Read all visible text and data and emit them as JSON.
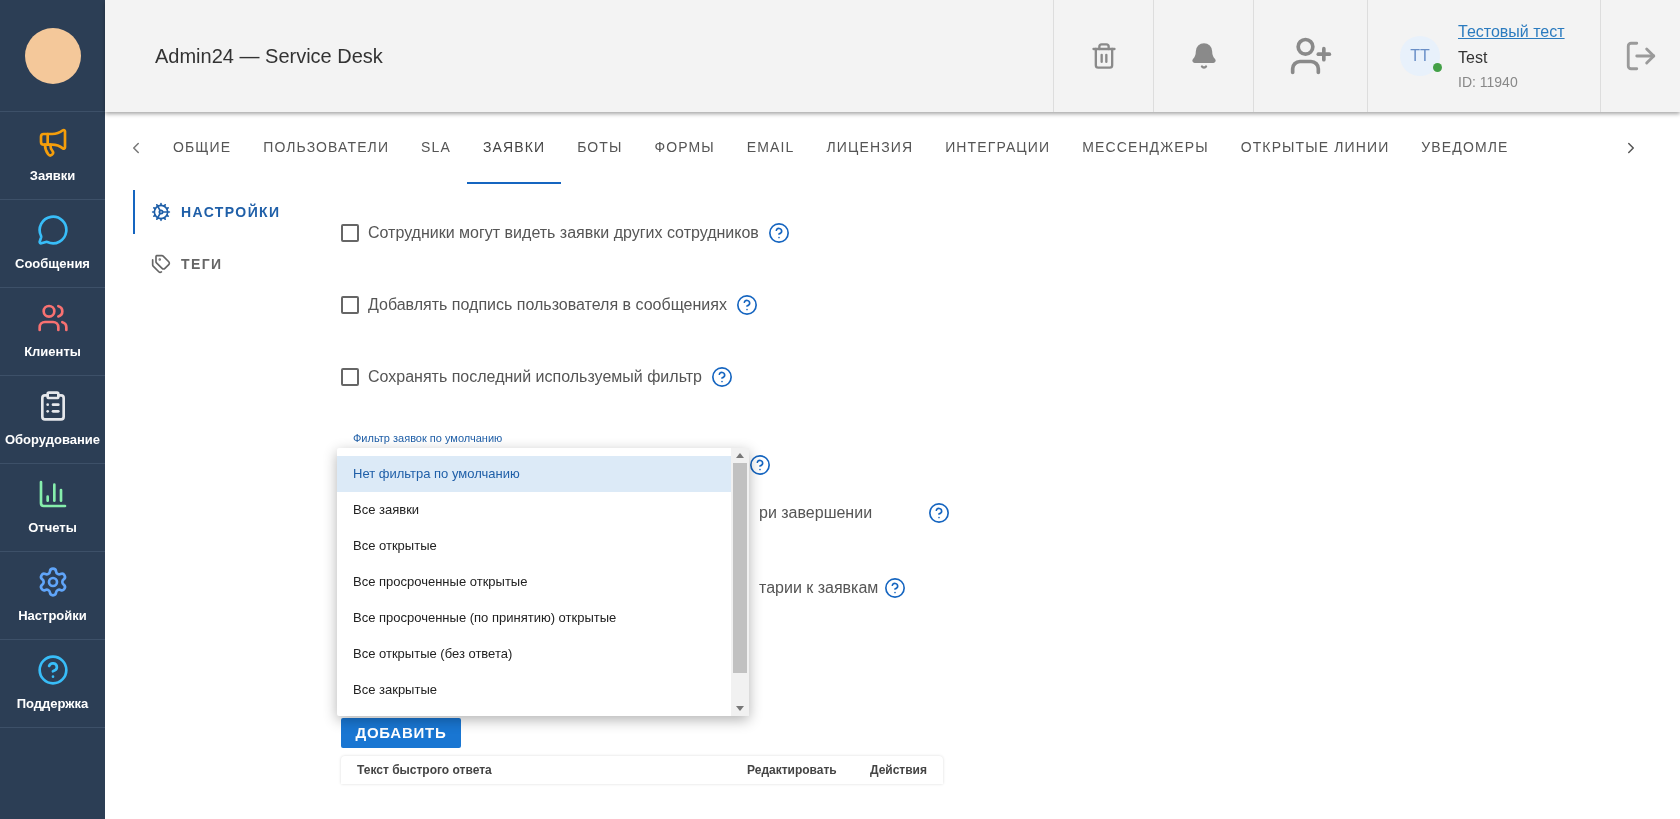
{
  "sidebar": {
    "items": [
      {
        "label": "Заявки"
      },
      {
        "label": "Сообщения"
      },
      {
        "label": "Клиенты"
      },
      {
        "label": "Оборудование"
      },
      {
        "label": "Отчеты"
      },
      {
        "label": "Настройки"
      },
      {
        "label": "Поддержка"
      }
    ]
  },
  "header": {
    "title": "Admin24 — Service Desk",
    "user": {
      "initials": "TT",
      "online": true,
      "name": "Тестовый тест",
      "login": "Test",
      "id": "ID: 11940"
    }
  },
  "tabs": [
    {
      "label": "ОБЩИЕ",
      "selected": false
    },
    {
      "label": "ПОЛЬЗОВАТЕЛИ",
      "selected": false
    },
    {
      "label": "SLA",
      "selected": false
    },
    {
      "label": "ЗАЯВКИ",
      "selected": true
    },
    {
      "label": "БОТЫ",
      "selected": false
    },
    {
      "label": "ФОРМЫ",
      "selected": false
    },
    {
      "label": "EMAIL",
      "selected": false
    },
    {
      "label": "ЛИЦЕНЗИЯ",
      "selected": false
    },
    {
      "label": "ИНТЕГРАЦИИ",
      "selected": false
    },
    {
      "label": "МЕССЕНДЖЕРЫ",
      "selected": false
    },
    {
      "label": "ОТКРЫТЫЕ ЛИНИИ",
      "selected": false
    },
    {
      "label": "УВЕДОМЛЕ",
      "selected": false
    }
  ],
  "subnav": [
    {
      "label": "НАСТРОЙКИ",
      "selected": true
    },
    {
      "label": "ТЕГИ",
      "selected": false
    }
  ],
  "settings": [
    {
      "label": "Сотрудники могут видеть заявки других сотрудников",
      "checked": false
    },
    {
      "label": "Добавлять подпись пользователя в сообщениях",
      "checked": false
    },
    {
      "label": "Сохранять последний используемый фильтр",
      "checked": false
    }
  ],
  "filter_select": {
    "label": "Фильтр заявок по умолчанию",
    "options": [
      {
        "label": "Нет фильтра по умолчанию",
        "selected": true
      },
      {
        "label": "Все заявки",
        "selected": false
      },
      {
        "label": "Все открытые",
        "selected": false
      },
      {
        "label": "Все просроченные открытые",
        "selected": false
      },
      {
        "label": "Все просроченные (по принятию) открытые",
        "selected": false
      },
      {
        "label": "Все открытые (без ответа)",
        "selected": false
      },
      {
        "label": "Все закрытые",
        "selected": false
      }
    ]
  },
  "hidden_rows": [
    "ри завершении",
    "тарии к заявкам"
  ],
  "add_button": "ДОБАВИТЬ",
  "table": {
    "columns": [
      "Текст быстрого ответа",
      "Редактировать",
      "Действия"
    ]
  }
}
